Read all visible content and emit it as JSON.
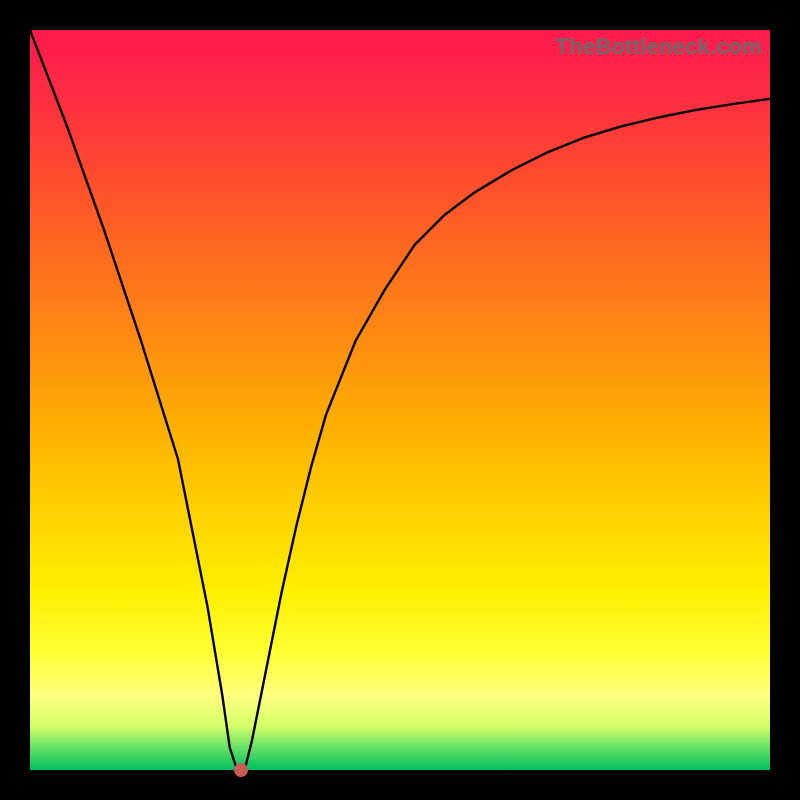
{
  "watermark": "TheBottleneck.com",
  "chart_data": {
    "type": "line",
    "title": "",
    "xlabel": "",
    "ylabel": "",
    "xlim": [
      0,
      100
    ],
    "ylim": [
      0,
      100
    ],
    "grid": false,
    "series": [
      {
        "name": "curve",
        "x": [
          0,
          5,
          10,
          15,
          20,
          24,
          26,
          27,
          28,
          29,
          30,
          32,
          34,
          36,
          38,
          40,
          44,
          48,
          52,
          56,
          60,
          65,
          70,
          75,
          80,
          85,
          90,
          95,
          100
        ],
        "y": [
          100,
          87,
          73,
          58,
          42,
          22,
          10,
          3,
          0,
          0,
          4,
          14,
          24,
          33,
          41,
          48,
          58,
          65,
          71,
          75,
          78,
          81,
          83.5,
          85.5,
          87,
          88.2,
          89.2,
          90,
          90.7
        ]
      }
    ],
    "marker": {
      "x": 28.5,
      "y": 0
    },
    "colors": {
      "curve": "#000000",
      "marker": "#c95b55",
      "gradient_top": "#ff1a4d",
      "gradient_bottom": "#00c060"
    }
  }
}
